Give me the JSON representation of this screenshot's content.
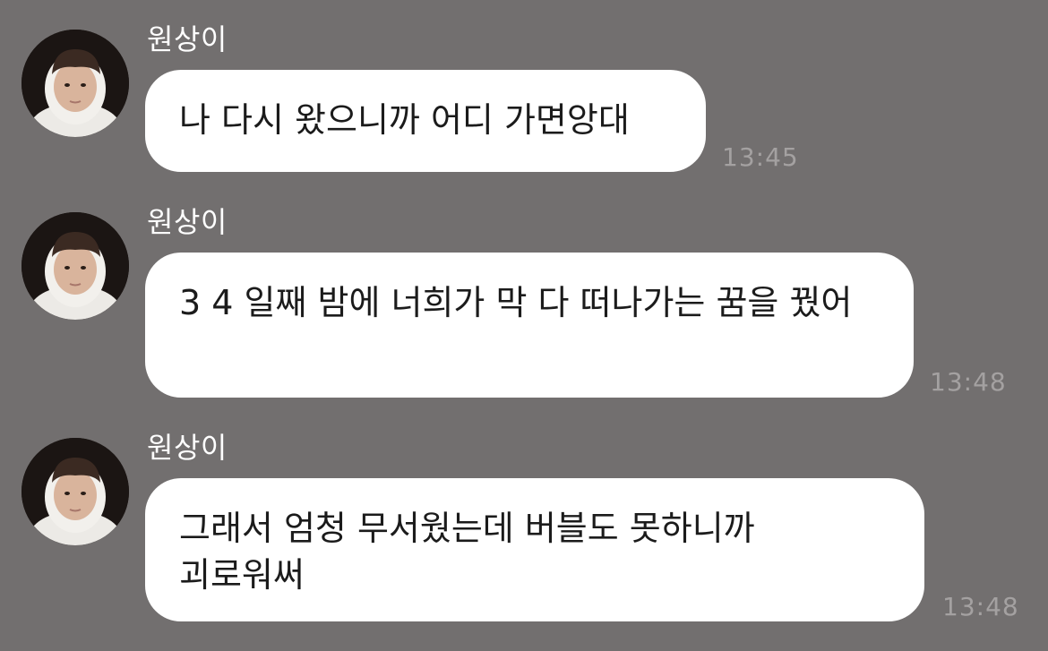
{
  "chat": {
    "messages": [
      {
        "sender": "원상이",
        "avatar_icon": "profile-photo-hooded-person",
        "text": "나 다시 왔으니까 어디 가면앙대",
        "time": "13:45"
      },
      {
        "sender": "원상이",
        "avatar_icon": "profile-photo-hooded-person",
        "text": "3 4 일째 밤에 너희가 막 다 떠나가는 꿈을 꿨어",
        "time": "13:48"
      },
      {
        "sender": "원상이",
        "avatar_icon": "profile-photo-hooded-person",
        "text": "그래서 엄청 무서웠는데 버블도 못하니까 괴로워써",
        "time": "13:48"
      }
    ]
  },
  "colors": {
    "background": "#726f6f",
    "bubble": "#ffffff",
    "sender_text": "#ffffff",
    "message_text": "#1b1b1b",
    "timestamp": "#a4a1a1"
  }
}
